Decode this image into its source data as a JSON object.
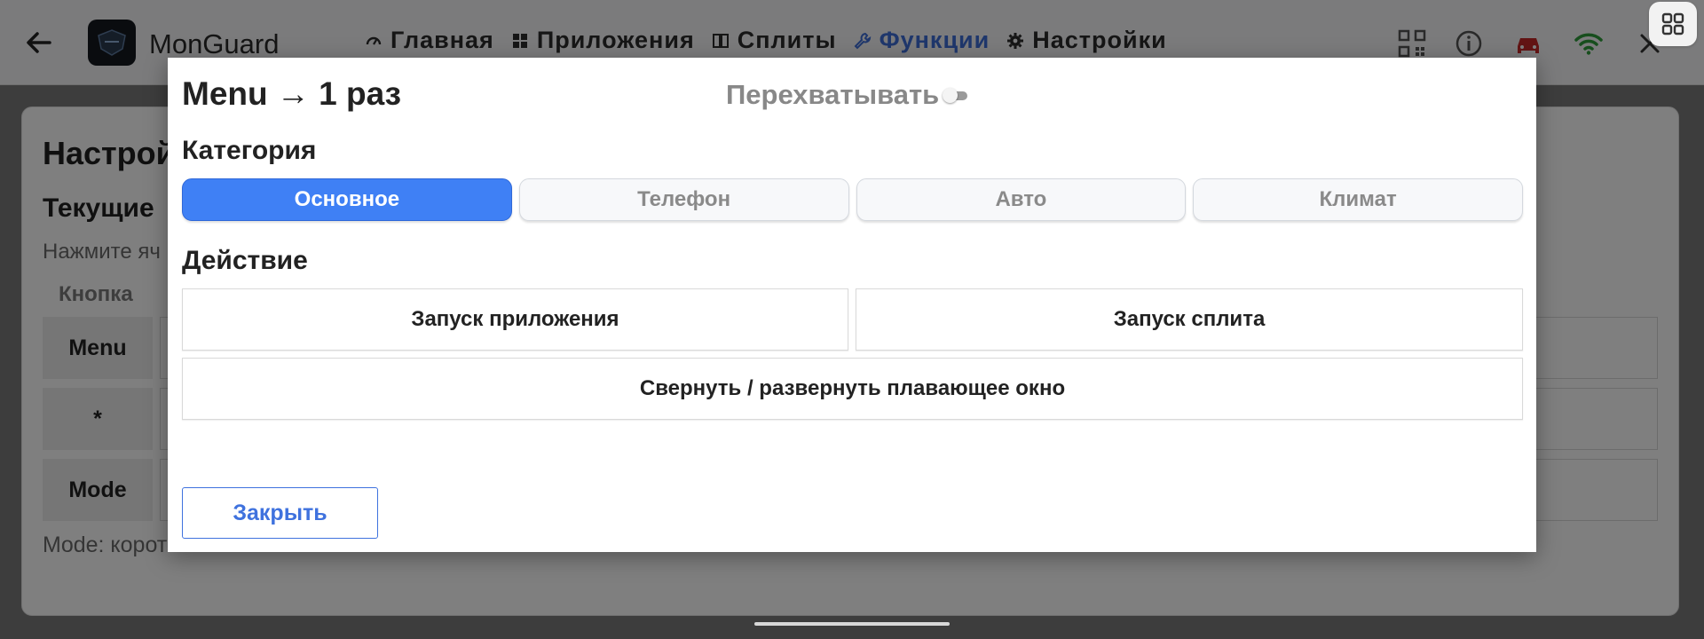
{
  "appbar": {
    "app_name": "MonGuard",
    "nav": [
      {
        "label": "Главная",
        "icon": "speedometer-icon",
        "active": false
      },
      {
        "label": "Приложения",
        "icon": "grid-icon",
        "active": false
      },
      {
        "label": "Сплиты",
        "icon": "split-icon",
        "active": false
      },
      {
        "label": "Функции",
        "icon": "wrench-icon",
        "active": true
      },
      {
        "label": "Настройки",
        "icon": "gear-icon",
        "active": false
      }
    ],
    "right_icons": [
      "qr-code-icon",
      "info-icon",
      "car-icon",
      "wifi-icon",
      "close-icon"
    ],
    "accent_color": "#3f6fd8",
    "car_icon_color": "#c62828",
    "wifi_icon_color": "#2e9d3a"
  },
  "background": {
    "title": "Настрой",
    "subtitle": "Текущие",
    "hint": "Нажмите яч",
    "column_header": "Кнопка",
    "rows": [
      {
        "label": "Menu"
      },
      {
        "label": "*"
      },
      {
        "label": "Mode"
      }
    ],
    "footnote": "Mode: корот"
  },
  "dialog": {
    "title": "Menu → 1 раз",
    "intercept_label": "Перехватывать",
    "intercept_enabled": false,
    "category_label": "Категория",
    "categories": [
      {
        "label": "Основное",
        "active": true
      },
      {
        "label": "Телефон",
        "active": false
      },
      {
        "label": "Авто",
        "active": false
      },
      {
        "label": "Климат",
        "active": false
      }
    ],
    "action_label": "Действие",
    "actions": {
      "launch_app": "Запуск приложения",
      "launch_split": "Запуск сплита",
      "toggle_floating": "Свернуть / развернуть плавающее окно"
    },
    "close_label": "Закрыть",
    "active_color": "#3f80f5"
  }
}
